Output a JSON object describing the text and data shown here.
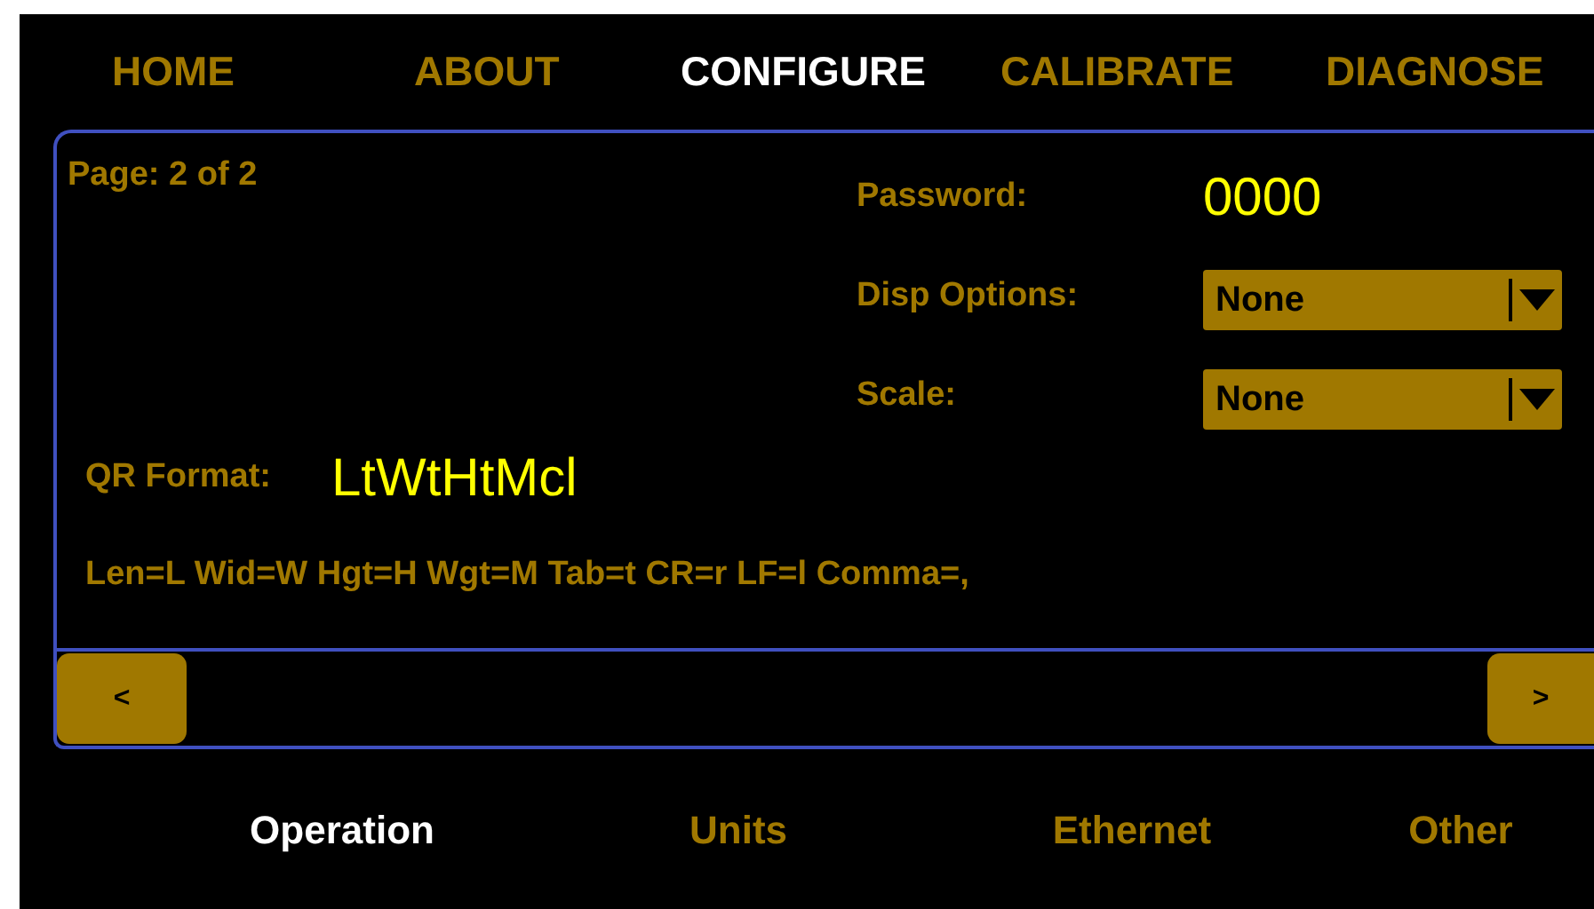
{
  "nav_tabs": [
    {
      "label": "HOME",
      "selected": false
    },
    {
      "label": "ABOUT",
      "selected": false
    },
    {
      "label": "CONFIGURE",
      "selected": true
    },
    {
      "label": "CALIBRATE",
      "selected": false
    },
    {
      "label": "DIAGNOSE",
      "selected": false
    }
  ],
  "page_indicator": "Page: 2 of 2",
  "fields": [
    {
      "kind": "value",
      "label": "Password:",
      "value": "0000"
    },
    {
      "kind": "dropdown",
      "label": "Disp Options:",
      "value": "None"
    },
    {
      "kind": "dropdown",
      "label": "Scale:",
      "value": "None"
    }
  ],
  "qr_format": {
    "label": "QR Format:",
    "value": "LtWtHtMcl"
  },
  "legend": "Len=L Wid=W Hgt=H Wgt=M Tab=t CR=r LF=l Comma=,",
  "prev_button": "<",
  "next_button": ">",
  "sub_tabs": [
    {
      "label": "Operation",
      "selected": true
    },
    {
      "label": "Units",
      "selected": false
    },
    {
      "label": "Ethernet",
      "selected": false
    },
    {
      "label": "Other",
      "selected": false
    }
  ]
}
